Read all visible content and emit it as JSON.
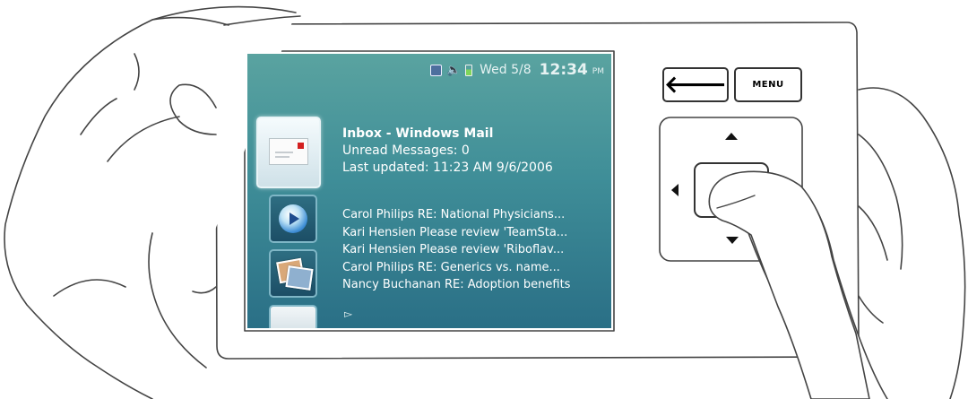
{
  "status_bar": {
    "date": "Wed 5/8",
    "time": "12:34",
    "ampm": "PM",
    "icons": [
      "network-icon",
      "volume-icon",
      "battery-icon"
    ]
  },
  "tiles": [
    {
      "name": "mail-tile",
      "icon": "envelope-icon",
      "selected": true
    },
    {
      "name": "media-tile",
      "icon": "media-player-icon",
      "selected": false
    },
    {
      "name": "photos-tile",
      "icon": "photos-icon",
      "selected": false
    },
    {
      "name": "partial-tile",
      "icon": "document-icon",
      "selected": false
    }
  ],
  "detail": {
    "title": "Inbox - Windows Mail",
    "unread": "Unread Messages: 0",
    "updated": "Last updated: 11:23 AM 9/6/2006"
  },
  "messages": [
    "Carol Philips RE: National Physicians...",
    "Kari Hensien Please review 'TeamSta...",
    "Kari Hensien Please review 'Riboflav...",
    "Carol Philips RE: Generics vs. name...",
    "Nancy Buchanan RE: Adoption benefits"
  ],
  "more_indicator": "▻",
  "controls": {
    "back_icon": "🡐",
    "menu_label": "MENU"
  },
  "colors": {
    "screen_top": "#5aa3a0",
    "screen_bottom": "#2a6f86",
    "device_outline": "#333333"
  }
}
